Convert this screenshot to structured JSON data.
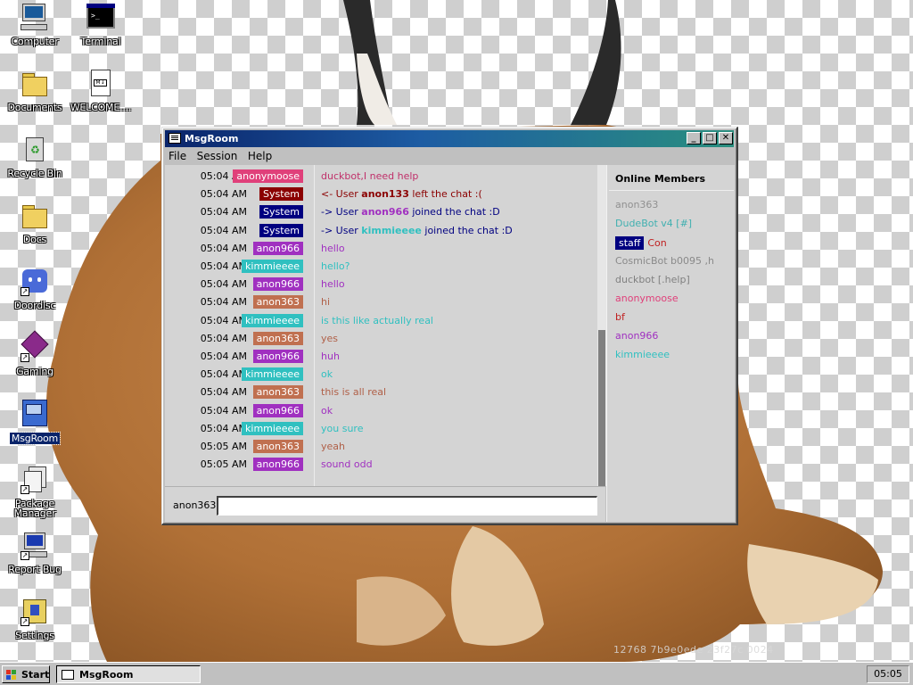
{
  "desktop": {
    "icons": [
      {
        "label": "Computer"
      },
      {
        "label": "Terminal"
      },
      {
        "label": "Documents"
      },
      {
        "label": "WELCOME...."
      },
      {
        "label": "Recycle Bin"
      },
      {
        "label": "Docs"
      },
      {
        "label": "Doordisc"
      },
      {
        "label": "Gaming"
      },
      {
        "label": "MsgRoom"
      },
      {
        "label": "Package Manager"
      },
      {
        "label": "Report Bug"
      },
      {
        "label": "Settings"
      }
    ],
    "watermark": "12768 7b9e0ede 23f27c 0024"
  },
  "window": {
    "title": "MsgRoom",
    "controls": {
      "minimize": "_",
      "maximize": "□",
      "close": "✕"
    },
    "menu": [
      "File",
      "Session",
      "Help"
    ]
  },
  "chat": {
    "messages": [
      {
        "time": "05:04 AM",
        "user": "anonymoose",
        "badge_color": "#e0407a",
        "text_color": "#c0306a",
        "parts": [
          {
            "t": "duckbot,I need help",
            "b": false
          }
        ]
      },
      {
        "time": "05:04 AM",
        "user": "System",
        "badge_color": "#8b0000",
        "text_color": "#8b0000",
        "parts": [
          {
            "t": "<- User ",
            "b": false
          },
          {
            "t": "anon133",
            "b": true
          },
          {
            "t": " left the chat :(",
            "b": false
          }
        ]
      },
      {
        "time": "05:04 AM",
        "user": "System",
        "badge_color": "#000080",
        "text_color": "#000080",
        "parts": [
          {
            "t": "-> User ",
            "b": false
          },
          {
            "t": "anon966",
            "b": true,
            "c": "#a030c0"
          },
          {
            "t": " joined the chat :D",
            "b": false
          }
        ]
      },
      {
        "time": "05:04 AM",
        "user": "System",
        "badge_color": "#000080",
        "text_color": "#000080",
        "parts": [
          {
            "t": "-> User ",
            "b": false
          },
          {
            "t": "kimmieeee",
            "b": true,
            "c": "#30c0c0"
          },
          {
            "t": " joined the chat :D",
            "b": false
          }
        ]
      },
      {
        "time": "05:04 AM",
        "user": "anon966",
        "badge_color": "#a030c0",
        "text_color": "#a030c0",
        "parts": [
          {
            "t": "hello",
            "b": false
          }
        ]
      },
      {
        "time": "05:04 AM",
        "user": "kimmieeee",
        "badge_color": "#30c0c0",
        "text_color": "#30c0c0",
        "parts": [
          {
            "t": "hello?",
            "b": false
          }
        ]
      },
      {
        "time": "05:04 AM",
        "user": "anon966",
        "badge_color": "#a030c0",
        "text_color": "#a030c0",
        "parts": [
          {
            "t": "hello",
            "b": false
          }
        ]
      },
      {
        "time": "05:04 AM",
        "user": "anon363",
        "badge_color": "#c07050",
        "text_color": "#b06048",
        "parts": [
          {
            "t": "hi",
            "b": false
          }
        ]
      },
      {
        "time": "05:04 AM",
        "user": "kimmieeee",
        "badge_color": "#30c0c0",
        "text_color": "#30c0c0",
        "parts": [
          {
            "t": "is this like actually real",
            "b": false
          }
        ]
      },
      {
        "time": "05:04 AM",
        "user": "anon363",
        "badge_color": "#c07050",
        "text_color": "#b06048",
        "parts": [
          {
            "t": "yes",
            "b": false
          }
        ]
      },
      {
        "time": "05:04 AM",
        "user": "anon966",
        "badge_color": "#a030c0",
        "text_color": "#a030c0",
        "parts": [
          {
            "t": "huh",
            "b": false
          }
        ]
      },
      {
        "time": "05:04 AM",
        "user": "kimmieeee",
        "badge_color": "#30c0c0",
        "text_color": "#30c0c0",
        "parts": [
          {
            "t": "ok",
            "b": false
          }
        ]
      },
      {
        "time": "05:04 AM",
        "user": "anon363",
        "badge_color": "#c07050",
        "text_color": "#b06048",
        "parts": [
          {
            "t": "this is all real",
            "b": false
          }
        ]
      },
      {
        "time": "05:04 AM",
        "user": "anon966",
        "badge_color": "#a030c0",
        "text_color": "#a030c0",
        "parts": [
          {
            "t": "ok",
            "b": false
          }
        ]
      },
      {
        "time": "05:04 AM",
        "user": "kimmieeee",
        "badge_color": "#30c0c0",
        "text_color": "#30c0c0",
        "parts": [
          {
            "t": "you sure",
            "b": false
          }
        ]
      },
      {
        "time": "05:05 AM",
        "user": "anon363",
        "badge_color": "#c07050",
        "text_color": "#b06048",
        "parts": [
          {
            "t": "yeah",
            "b": false
          }
        ]
      },
      {
        "time": "05:05 AM",
        "user": "anon966",
        "badge_color": "#a030c0",
        "text_color": "#a030c0",
        "parts": [
          {
            "t": "sound odd",
            "b": false
          }
        ]
      }
    ],
    "input": {
      "username": "anon363",
      "value": ""
    }
  },
  "members": {
    "heading": "Online Members",
    "list": [
      {
        "name": "anon363",
        "color": "#909090"
      },
      {
        "name": "DudeBot v4 [#]",
        "color": "#40b0b0"
      },
      {
        "name": "Con",
        "color": "#c02020",
        "staff": "staff"
      },
      {
        "name": "CosmicBot b0095 ,h",
        "color": "#8a8a8a"
      },
      {
        "name": "duckbot [.help]",
        "color": "#808080"
      },
      {
        "name": "anonymoose",
        "color": "#e0407a"
      },
      {
        "name": "bf",
        "color": "#c02020"
      },
      {
        "name": "anon966",
        "color": "#a030c0"
      },
      {
        "name": "kimmieeee",
        "color": "#30c0c0"
      }
    ]
  },
  "taskbar": {
    "start_label": "Start",
    "tasks": [
      {
        "label": "MsgRoom"
      }
    ],
    "clock": "05:05"
  }
}
